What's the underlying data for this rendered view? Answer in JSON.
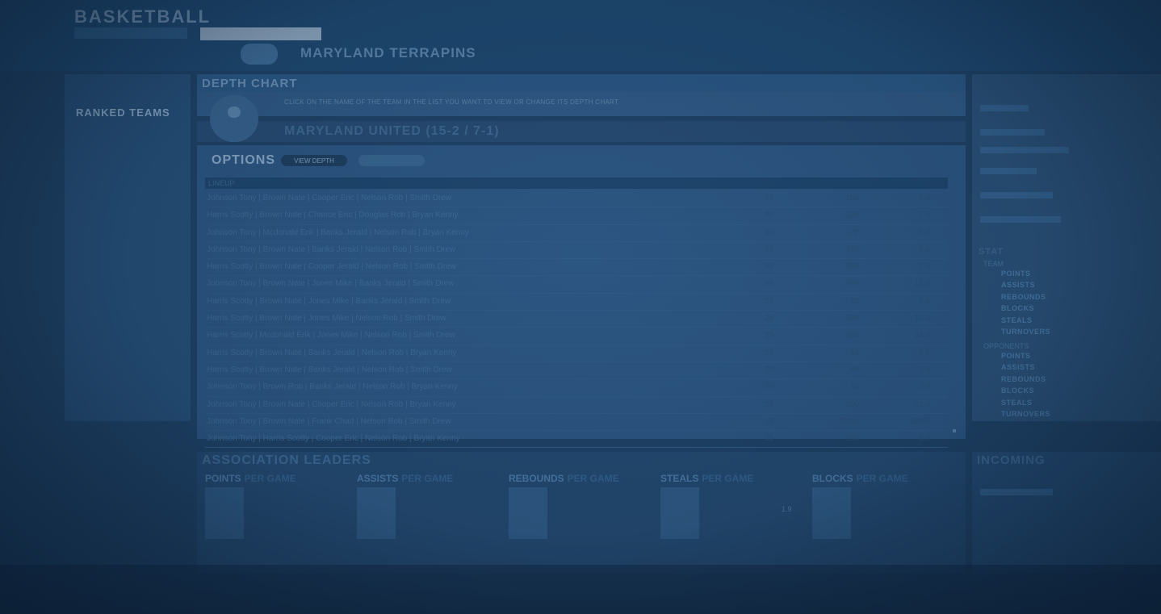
{
  "header": {
    "brand": "BASKETBALL",
    "top_note": "",
    "search_placeholder": "",
    "team_banner": "MARYLAND TERRAPINS",
    "links": []
  },
  "sidebar": {
    "title": "",
    "subtitle": "",
    "ranked_title": "RANKED TEAMS",
    "items": [
      "",
      "",
      "",
      "",
      "",
      "",
      "",
      "",
      "",
      "",
      "",
      "",
      "",
      "",
      "",
      "",
      "",
      "",
      "",
      "",
      "",
      "",
      "",
      ""
    ]
  },
  "depth_chart": {
    "title": "DEPTH CHART",
    "instructions": "CLICK ON THE NAME OF THE TEAM IN THE LIST YOU WANT TO VIEW OR CHANGE ITS DEPTH CHART",
    "team_name": "MARYLAND UNITED (15-2 / 7-1)",
    "options_label": "OPTIONS",
    "view_button": "VIEW DEPTH",
    "other_button": "",
    "table_head": {
      "lineup": "LINEUP",
      "c1": "",
      "c2": "",
      "c3": ""
    },
    "rows": [
      {
        "lineup": "Johnson Tony  |  Brown Nate  |  Cooper Eric  |  Nelson Rob  |  Smith Drew",
        "c1": "30",
        "c2": "184",
        "c3": "5.0"
      },
      {
        "lineup": "Harris Scotty  |  Brown Nate  |  Chance Eric  |  Douglas Rob  |  Bryan Kenny",
        "c1": "30",
        "c2": "180",
        "c3": "7.5"
      },
      {
        "lineup": "Johnson Tony  |  Mcdonald Erik  |  Banks Jerald  |  Nelson Rob  |  Bryan Kenny",
        "c1": "30",
        "c2": "172",
        "c3": "5.0"
      },
      {
        "lineup": "Johnson Tony  |  Brown Nate  |  Banks Jerald  |  Nelson Rob  |  Smith Drew",
        "c1": "30",
        "c2": "170",
        "c3": "8.0"
      },
      {
        "lineup": "Harris Scotty  |  Brown Nate  |  Cooper Jerald  |  Nelson Rob  |  Smith Drew",
        "c1": "30",
        "c2": "168",
        "c3": "7.5"
      },
      {
        "lineup": "Johnson Tony  |  Brown Nate  |  Jones Mike  |  Banks Jerald  |  Smith Drew",
        "c1": "30",
        "c2": "160",
        "c3": "12.0"
      },
      {
        "lineup": "Harris Scotty  |  Brown Nate  |  Jones Mike  |  Banks Jerald  |  Smith Drew",
        "c1": "25",
        "c2": "15",
        "c3": "7.5"
      },
      {
        "lineup": "Harris Scotty  |  Brown Nate  |  Jones Mike  |  Nelson Rob  |  Smith Drew",
        "c1": "25",
        "c2": "204",
        "c3": "14.0"
      },
      {
        "lineup": "Harris Scotty  |  Mcdonald Erik  |  Jones Mike  |  Nelson Rob  |  Smith Drew",
        "c1": "25",
        "c2": "105",
        "c3": "24.0"
      },
      {
        "lineup": "Harris Scotty  |  Brown Nate  |  Banks Jerald  |  Nelson Rob  |  Bryan Kenny",
        "c1": "20",
        "c2": "64",
        "c3": "4.0"
      },
      {
        "lineup": "Harris Scotty  |  Brown Nate  |  Banks Jerald  |  Nelson Rob  |  Smith Drew",
        "c1": "20",
        "c2": "64",
        "c3": "3.5"
      },
      {
        "lineup": "Johnson Tony  |  Brown Rob  |  Banks Jerald  |  Nelson Rob  |  Bryan Kenny",
        "c1": "20",
        "c2": "15",
        "c3": "2.0"
      },
      {
        "lineup": "Johnson Tony  |  Brown Nate  |  Cooper Eric  |  Nelson Rob  |  Bryan Kenny",
        "c1": "20",
        "c2": "500",
        "c3": "41.0"
      },
      {
        "lineup": "Johnson Tony  |  Brown Nate  |  Frank Chad  |  Nelson Rob  |  Smith Drew",
        "c1": "15",
        "c2": "264.4",
        "c3": "240.0"
      },
      {
        "lineup": "Johnson Tony  |  Harris Scotty  |  Cooper Eric  |  Nelson Rob  |  Bryan Kenny",
        "c1": "15",
        "c2": "104",
        "c3": "9.0"
      }
    ]
  },
  "stats_panel": {
    "title": "STAT",
    "team_label": "TEAM",
    "team_items": [
      "POINTS",
      "ASSISTS",
      "REBOUNDS",
      "BLOCKS",
      "STEALS",
      "TURNOVERS"
    ],
    "opp_label": "OPPONENTS",
    "opp_items": [
      "POINTS",
      "ASSISTS",
      "REBOUNDS",
      "BLOCKS",
      "STEALS",
      "TURNOVERS"
    ]
  },
  "leaders": {
    "title": "ASSOCIATION LEADERS",
    "subtitle": "",
    "columns": [
      {
        "stat": "POINTS",
        "suffix": "PER GAME",
        "entries": [
          {
            "name": "",
            "value": ""
          },
          {
            "name": "",
            "value": ""
          }
        ]
      },
      {
        "stat": "ASSISTS",
        "suffix": "PER GAME",
        "entries": [
          {
            "name": "",
            "value": ""
          },
          {
            "name": "",
            "value": ""
          }
        ]
      },
      {
        "stat": "REBOUNDS",
        "suffix": "PER GAME",
        "entries": [
          {
            "name": "",
            "value": ""
          },
          {
            "name": "",
            "value": ""
          }
        ]
      },
      {
        "stat": "STEALS",
        "suffix": "PER GAME",
        "entries": [
          {
            "name": "",
            "value": "1.9"
          },
          {
            "name": "",
            "value": ""
          }
        ]
      },
      {
        "stat": "BLOCKS",
        "suffix": "PER GAME",
        "entries": [
          {
            "name": "",
            "value": ""
          },
          {
            "name": "",
            "value": ""
          }
        ]
      }
    ]
  },
  "incoming": {
    "title": "INCOMING"
  },
  "colors": {
    "overlay": "#0e2338",
    "panel": "#2c5682",
    "accent": "#8aa8c6"
  }
}
